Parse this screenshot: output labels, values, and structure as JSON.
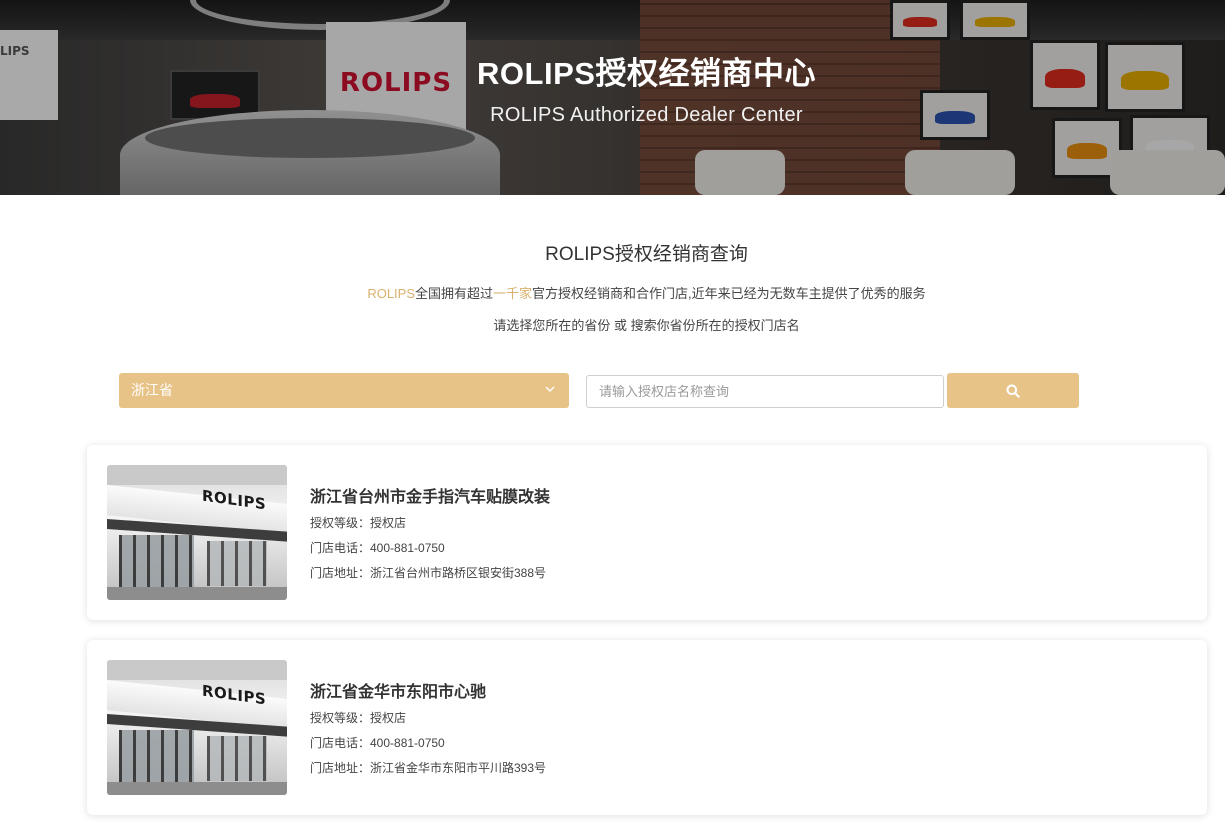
{
  "hero": {
    "title": "ROLIPS授权经销商中心",
    "subtitle": "ROLIPS Authorized Dealer Center",
    "scene_texts": {
      "sign": "ROLIPS",
      "left_sign": "LIPS"
    }
  },
  "intro": {
    "title": "ROLIPS授权经销商查询",
    "brand": "ROLIPS",
    "text_a": "全国拥有超过",
    "highlight": "一千家",
    "text_b": "官方授权经销商和合作门店,近年来已经为无数车主提供了优秀的服务",
    "hint": "请选择您所在的省份 或 搜索你省份所在的授权门店名"
  },
  "search": {
    "province": "浙江省",
    "placeholder": "请输入授权店名称查询",
    "button_icon": "search-icon"
  },
  "colors": {
    "accent": "#e8c388",
    "highlight_text": "#d9b06c"
  },
  "dealers": [
    {
      "name": "浙江省台州市金手指汽车贴膜改装",
      "level": "授权等级：授权店",
      "phone": "门店电话：400-881-0750",
      "address": "门店地址：浙江省台州市路桥区银安街388号",
      "photo_logo": "ROLIPS"
    },
    {
      "name": "浙江省金华市东阳市心驰",
      "level": "授权等级：授权店",
      "phone": "门店电话：400-881-0750",
      "address": "门店地址：浙江省金华市东阳市平川路393号",
      "photo_logo": "ROLIPS"
    }
  ]
}
